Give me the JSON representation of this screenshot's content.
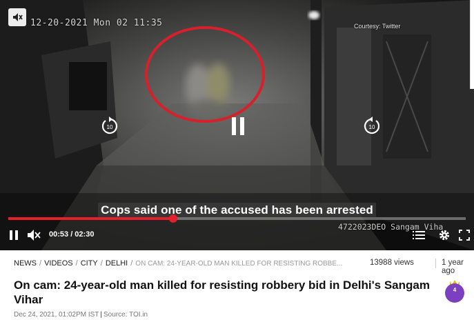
{
  "player": {
    "cctv_timestamp": "12-20-2021 Mon 02 11:35",
    "courtesy": "Courtesy: Twitter",
    "subtitle": "Cops said one of the accused has been arrested",
    "cctv_id": "4722023DEO Sangam Viha",
    "rewind_seconds": "10",
    "forward_seconds": "10",
    "time_display": "00:53 / 02:30",
    "progress": 0.36,
    "accent_color": "#e3202b"
  },
  "meta": {
    "breadcrumb": [
      "NEWS",
      "VIDEOS",
      "CITY",
      "DELHI"
    ],
    "breadcrumb_current": "ON CAM: 24-YEAR-OLD MAN KILLED FOR RESISTING ROBBE...",
    "views": "13988 views",
    "age": "1 year ago"
  },
  "headline": "On cam: 24-year-old man killed for resisting robbery bid in Delhi's Sangam Vihar",
  "badge": {
    "count": "4",
    "color": "#7b3fbf"
  },
  "dateline": {
    "date": "Dec 24, 2021, 01:02PM IST",
    "source": "Source: TOI.in"
  }
}
